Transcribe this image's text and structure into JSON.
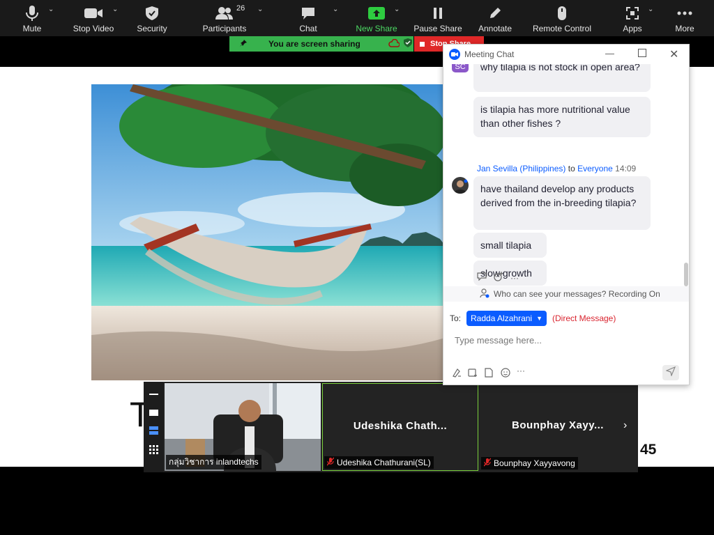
{
  "toolbar": {
    "mute": "Mute",
    "stop_video": "Stop Video",
    "security": "Security",
    "participants": "Participants",
    "participants_count": "26",
    "chat": "Chat",
    "new_share": "New Share",
    "pause_share": "Pause Share",
    "annotate": "Annotate",
    "remote_control": "Remote Control",
    "apps": "Apps",
    "more": "More"
  },
  "share_bar": {
    "status": "You are screen sharing",
    "stop": "Stop Share"
  },
  "slide": {
    "title_letter": "T",
    "page_number": "45"
  },
  "video_strip": {
    "tiles": [
      {
        "label": "กลุ่มวิชาการ inlandtechs"
      },
      {
        "display_name": "Udeshika  Chath...",
        "label": "Udeshika Chathurani(SL)"
      },
      {
        "display_name": "Bounphay  Xayy...",
        "label": "Bounphay Xayyavong"
      }
    ]
  },
  "chat": {
    "title": "Meeting Chat",
    "avatar_initials": "SC",
    "messages": [
      "why tilapia is not stock in open area?",
      "is tilapia has more nutritional value than other fishes ?",
      "have thailand develop any products derived from the in-breeding tilapia?",
      "small tilapia",
      "slow growth"
    ],
    "sender_name": "Jan Sevilla (Philippines)",
    "sender_to": "to",
    "sender_audience": "Everyone",
    "sender_time": "14:09",
    "privacy": "Who can see your messages? Recording On",
    "to_label": "To:",
    "recipient": "Radda Alzahrani",
    "direct_message": "(Direct Message)",
    "input_placeholder": "Type message here...",
    "reaction_more": "···",
    "toolbar_more": "···"
  },
  "colors": {
    "toolbar_bg": "#1a1a1a",
    "share_green": "#37b24d",
    "stop_red": "#e02828",
    "zoom_blue": "#0b5cff"
  }
}
